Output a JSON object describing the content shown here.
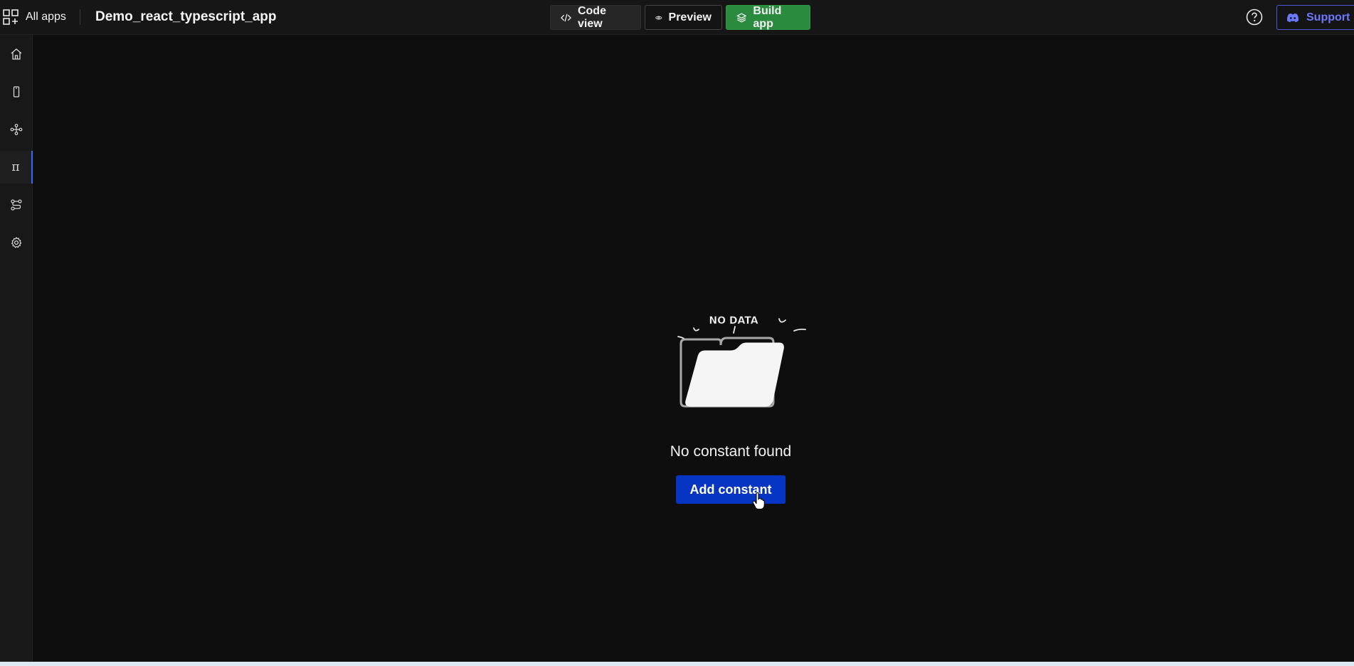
{
  "header": {
    "all_apps_label": "All apps",
    "app_title": "Demo_react_typescript_app",
    "code_view_label": "Code view",
    "preview_label": "Preview",
    "build_app_label": "Build app",
    "support_label": "Support"
  },
  "sidebar": {
    "items": [
      {
        "name": "home-icon",
        "active": false
      },
      {
        "name": "mobile-icon",
        "active": false
      },
      {
        "name": "network-icon",
        "active": false
      },
      {
        "name": "pi-icon",
        "glyph": "π",
        "active": true
      },
      {
        "name": "flow-icon",
        "active": false
      },
      {
        "name": "gear-icon",
        "active": false
      }
    ]
  },
  "empty_state": {
    "illustration_text": "NO DATA",
    "message": "No constant found",
    "button_label": "Add constant"
  },
  "colors": {
    "accent_blue": "#0635c4",
    "build_green": "#2a8a3e",
    "support_purple": "#6b78ff",
    "active_indicator": "#2f6bff"
  }
}
